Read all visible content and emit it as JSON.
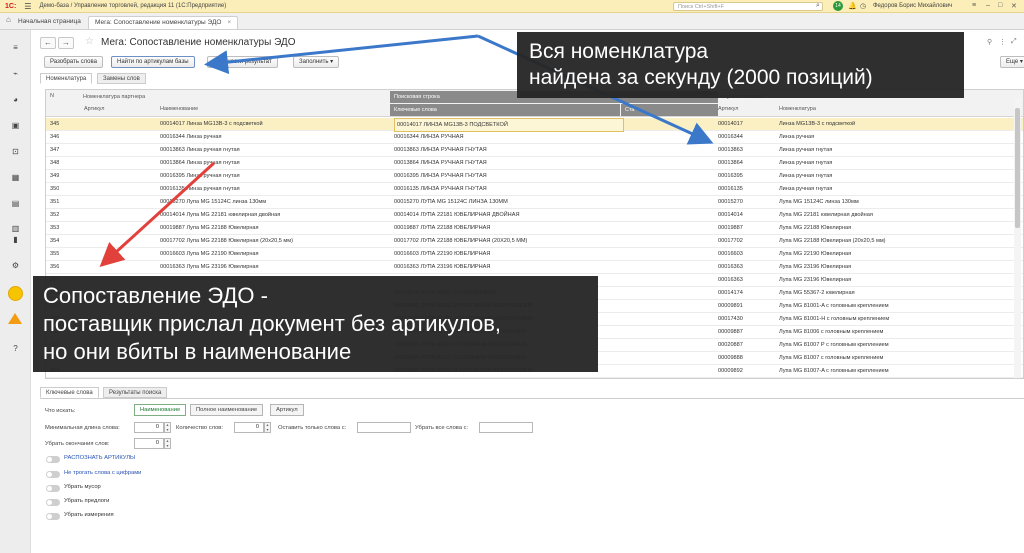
{
  "titlebar": {
    "logo": "1С:",
    "title": "Демо-база / Управление торговлей, редакция 11  (1С:Предприятие)",
    "search_placeholder": "Поиск Ctrl+Shift+F",
    "badge_count": "14",
    "user": "Федоров Борис Михайлович"
  },
  "tabs": {
    "home": "Начальная страница",
    "active": "Мега: Сопоставление номенклатуры ЭДО",
    "close": "×"
  },
  "form": {
    "title": "Мега: Сопоставление номенклатуры ЭДО",
    "more": "Еще",
    "buttons": {
      "split_words": "Разобрать слова",
      "find_by_articles": "Найти по артикулам базы",
      "transfer_result": "Перенести результат",
      "fill": "Заполнить"
    },
    "subtabs": [
      "Номенклатура",
      "Замены слов"
    ]
  },
  "grid": {
    "headers": {
      "n": "N",
      "partner_group": "Номенклатура партнера",
      "article": "Артикул",
      "name": "Наименование",
      "search_group": "Поисковая строка",
      "keywords": "Ключевые слова",
      "status": "Ста",
      "result_group": "Результат поиска",
      "result_article": "Артикул",
      "result_name": "Номенклатура"
    },
    "rows": [
      {
        "n": "345",
        "name": "00014017 Линза MG13B-3 с подсветкой",
        "kw": "00014017 ЛИНЗА MG13B-3 ПОДСВЕТКОЙ",
        "art": "00014017",
        "nom": "Линза MG13B-3 с подсветкой"
      },
      {
        "n": "346",
        "name": "00016344 Линза ручная",
        "kw": "00016344 ЛИНЗА РУЧНАЯ",
        "art": "00016344",
        "nom": "Линза ручная"
      },
      {
        "n": "347",
        "name": "00013863 Линза ручная гнутая",
        "kw": "00013863 ЛИНЗА РУЧНАЯ ГНУТАЯ",
        "art": "00013863",
        "nom": "Линза ручная гнутая"
      },
      {
        "n": "348",
        "name": "00013864 Линза ручная гнутая",
        "kw": "00013864 ЛИНЗА РУЧНАЯ ГНУТАЯ",
        "art": "00013864",
        "nom": "Линза ручная гнутая"
      },
      {
        "n": "349",
        "name": "00016395 Линза ручная гнутая",
        "kw": "00016395 ЛИНЗА РУЧНАЯ ГНУТАЯ",
        "art": "00016395",
        "nom": "Линза ручная гнутая"
      },
      {
        "n": "350",
        "name": "00016135 Линза ручная гнутая",
        "kw": "00016135 ЛИНЗА РУЧНАЯ ГНУТАЯ",
        "art": "00016135",
        "nom": "Линза ручная гнутая"
      },
      {
        "n": "351",
        "name": "00015270 Лупа MG 15124C линза 130мм",
        "kw": "00015270 ЛУПА MG 15124C ЛИНЗА 130ММ",
        "art": "00015270",
        "nom": "Лупа MG 15124C линза 130мм"
      },
      {
        "n": "352",
        "name": "00014014 Лупа MG 22181 ювелирная двойная",
        "kw": "00014014 ЛУПА 22181 ЮВЕЛИРНАЯ ДВОЙНАЯ",
        "art": "00014014",
        "nom": "Лупа MG 22181 ювелирная двойная"
      },
      {
        "n": "353",
        "name": "00019887 Лупа MG 22188 Ювелирная",
        "kw": "00019887 ЛУПА 22188 ЮВЕЛИРНАЯ",
        "art": "00019887",
        "nom": "Лупа MG 22188 Ювелирная"
      },
      {
        "n": "354",
        "name": "00017702 Лупа MG 22188 Ювелирная (20х20,5 мм)",
        "kw": "00017702 ЛУПА 22188 ЮВЕЛИРНАЯ (20Х20,5 ММ)",
        "art": "00017702",
        "nom": "Лупа MG 22188 Ювелирная (20х20,5 мм)"
      },
      {
        "n": "355",
        "name": "00016603 Лупа MG 22190 Ювелирная",
        "kw": "00016603 ЛУПА 22190 ЮВЕЛИРНАЯ",
        "art": "00016603",
        "nom": "Лупа MG 22190 Ювелирная"
      },
      {
        "n": "356",
        "name": "00016363 Лупа MG 23196 Ювелирная",
        "kw": "00016363 ЛУПА 23196 ЮВЕЛИРНАЯ",
        "art": "00016363",
        "nom": "Лупа MG 23196 Ювелирная"
      },
      {
        "n": "357",
        "name": "",
        "kw": "",
        "art": "00016363",
        "nom": "Лупа MG 23196 Ювелирная"
      },
      {
        "n": "358",
        "name": "",
        "kw": "00014174 ЛУПА 55367-2 ЮВЕЛИРНАЯ",
        "art": "00014174",
        "nom": "Лупа MG 55367-2 ювелирная"
      },
      {
        "n": "359",
        "name": "",
        "kw": "00009891 ЛУПА 81001-А ГОЛОВНЫМ КРЕПЛЕНИЕМ",
        "art": "00009891",
        "nom": "Лупа MG 81001-A с головным креплением"
      },
      {
        "n": "360",
        "name": "",
        "kw": "00017430 ЛУПА 81001-Н ГОЛОВНЫМ КРЕПЛЕНИЕМ",
        "art": "00017430",
        "nom": "Лупа MG 81001-Н с головным креплением"
      },
      {
        "n": "361",
        "name": "",
        "kw": "00009887 ЛУПА 81006 ГОЛОВНЫМ КРЕПЛЕНИЕМ",
        "art": "00009887",
        "nom": "Лупа MG 81006 с головным креплением"
      },
      {
        "n": "362",
        "name": "",
        "kw": "00020887 ЛУПА 81007 ГОЛОВНЫМ КРЕПЛЕНИЕМ",
        "art": "00020887",
        "nom": "Лупа MG 81007 Р с головным креплением"
      },
      {
        "n": "363",
        "name": "",
        "kw": "00009888 ЛУПА 81007 ГОЛОВНЫМ КРЕПЛЕНИЕМ",
        "art": "00009888",
        "nom": "Лупа MG 81007 с головным креплением"
      },
      {
        "n": "364",
        "name": "",
        "kw": "00009892 ЛУПА 81007-А ГОЛОВНЫМ КРЕПЛЕНИЕМ",
        "art": "00009892",
        "nom": "Лупа MG 81007-A с головным креплением"
      }
    ]
  },
  "bottom": {
    "tabs": [
      "Ключевые слова",
      "Результаты поиска"
    ],
    "what_to_search_label": "Что искать:",
    "what_options": [
      "Наименование",
      "Полное наименование",
      "Артикул"
    ],
    "min_word_len_label": "Минимальная длина слова:",
    "min_word_len_value": "0",
    "word_count_label": "Количество слов:",
    "word_count_value": "0",
    "keep_only_words_label": "Оставить только слова с:",
    "remove_all_words_label": "Убрать все слова с:",
    "remove_endings_label": "Убрать окончания слов:",
    "remove_endings_value": "0",
    "toggles": [
      {
        "label": "РАСПОЗНАТЬ АРТИКУЛЫ",
        "link": true
      },
      {
        "label": "Не трогать слова с цифрами",
        "link": true
      },
      {
        "label": "Убрать мусор",
        "link": false
      },
      {
        "label": "Убрать предлоги",
        "link": false
      },
      {
        "label": "Убрать измерения",
        "link": false
      }
    ]
  },
  "overlays": {
    "top": [
      "Вся номенклатура",
      "найдена за секунду (2000 позиций)"
    ],
    "bottom": [
      "Сопоставление ЭДО -",
      "поставщик прислал документ без артикулов,",
      "но они вбиты в наименование"
    ]
  },
  "colors": {
    "titlebar": "#fbeeb8",
    "selected_row": "#fbf0c4",
    "overlay_bg": "#262626",
    "arrow_blue": "#3b78c9",
    "arrow_red": "#e2403a",
    "badge_green": "#2c9a3a"
  }
}
